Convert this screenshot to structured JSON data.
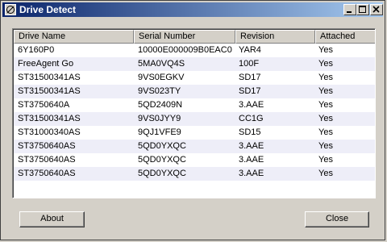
{
  "window": {
    "title": "Drive Detect"
  },
  "columns": [
    "Drive Name",
    "Serial Number",
    "Revision",
    "Attached"
  ],
  "rows": [
    [
      "6Y160P0",
      "10000E000009B0EAC0",
      "YAR4",
      "Yes"
    ],
    [
      "FreeAgent Go",
      "5MA0VQ4S",
      "100F",
      "Yes"
    ],
    [
      "ST31500341AS",
      "9VS0EGKV",
      "SD17",
      "Yes"
    ],
    [
      "ST31500341AS",
      "9VS023TY",
      "SD17",
      "Yes"
    ],
    [
      "ST3750640A",
      "5QD2409N",
      "3.AAE",
      "Yes"
    ],
    [
      "ST31500341AS",
      "9VS0JYY9",
      "CC1G",
      "Yes"
    ],
    [
      "ST31000340AS",
      "9QJ1VFE9",
      "SD15",
      "Yes"
    ],
    [
      "ST3750640AS",
      "5QD0YXQC",
      "3.AAE",
      "Yes"
    ],
    [
      "ST3750640AS",
      "5QD0YXQC",
      "3.AAE",
      "Yes"
    ],
    [
      "ST3750640AS",
      "5QD0YXQC",
      "3.AAE",
      "Yes"
    ]
  ],
  "buttons": {
    "about": "About",
    "close": "Close"
  },
  "icons": {
    "app": "drive-detect-icon",
    "minimize": "minimize-icon",
    "maximize": "maximize-icon",
    "close": "close-icon"
  },
  "colors": {
    "titlebar_start": "#0a246a",
    "titlebar_end": "#a6caf0",
    "alt_row": "#eeeef8",
    "face": "#d4d0c8"
  }
}
